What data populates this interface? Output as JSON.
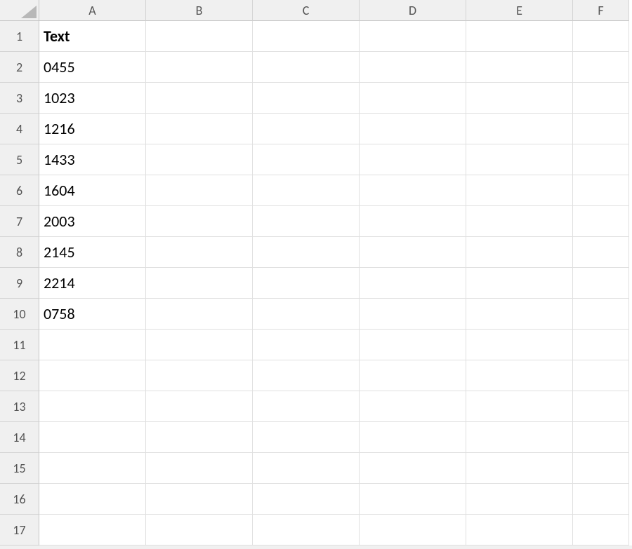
{
  "columns": [
    "A",
    "B",
    "C",
    "D",
    "E",
    "F"
  ],
  "rowCount": 17,
  "cells": {
    "A1": {
      "value": "Text",
      "bold": true
    },
    "A2": {
      "value": "0455"
    },
    "A3": {
      "value": "1023"
    },
    "A4": {
      "value": "1216"
    },
    "A5": {
      "value": "1433"
    },
    "A6": {
      "value": "1604"
    },
    "A7": {
      "value": "2003"
    },
    "A8": {
      "value": "2145"
    },
    "A9": {
      "value": "2214"
    },
    "A10": {
      "value": "0758"
    }
  }
}
